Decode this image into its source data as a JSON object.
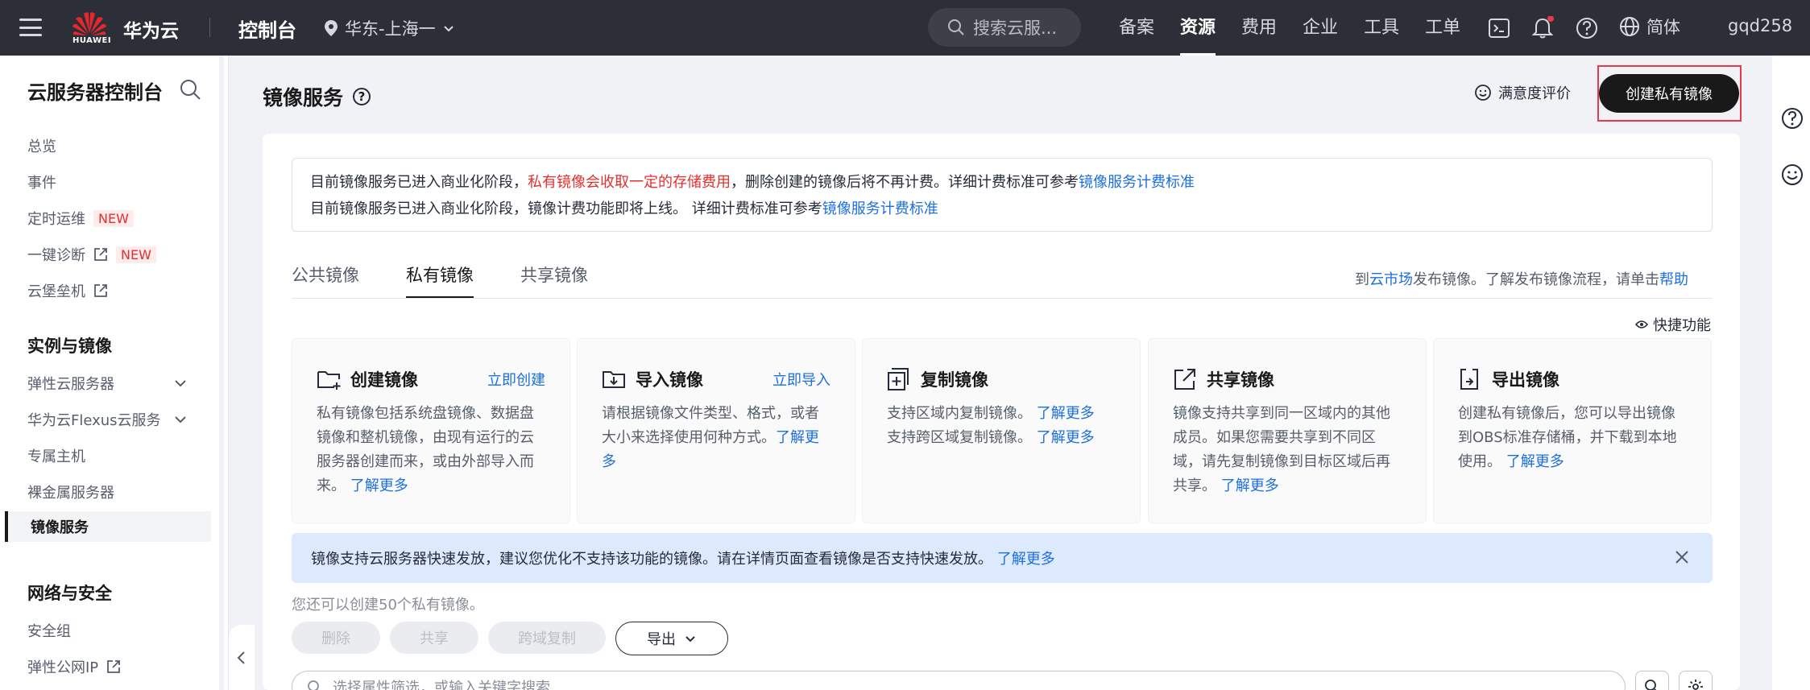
{
  "topbar": {
    "logo_text": "HUAWEI",
    "brand": "华为云",
    "console": "控制台",
    "region": "华东-上海一",
    "search_placeholder": "搜索云服...",
    "nav": [
      "备案",
      "资源",
      "费用",
      "企业",
      "工具",
      "工单"
    ],
    "active_nav": "资源",
    "language": "简体",
    "username": "gqd258"
  },
  "sidebar": {
    "title": "云服务器控制台",
    "items_top": [
      "总览",
      "事件"
    ],
    "scheduled_ops": "定时运维",
    "diagnosis": "一键诊断",
    "bastion": "云堡垒机",
    "new_badge": "NEW",
    "group_instances": "实例与镜像",
    "ecs": "弹性云服务器",
    "flexus": "华为云Flexus云服务",
    "dedicated_host": "专属主机",
    "bare_metal": "裸金属服务器",
    "ims": "镜像服务",
    "group_network": "网络与安全",
    "security_group": "安全组",
    "eip": "弹性公网IP"
  },
  "header": {
    "title": "镜像服务",
    "help_mark": "?",
    "satisfaction": "满意度评价",
    "create_button": "创建私有镜像"
  },
  "notice": {
    "line1_a": "目前镜像服务已进入商业化阶段，",
    "line1_red": "私有镜像会收取一定的存储费用",
    "line1_b": "，删除创建的镜像后将不再计费。详细计费标准可参考",
    "line1_link": "镜像服务计费标准",
    "line2_a": "目前镜像服务已进入商业化阶段，镜像计费功能即将上线。 详细计费标准可参考",
    "line2_link": "镜像服务计费标准"
  },
  "tabs": [
    "公共镜像",
    "私有镜像",
    "共享镜像"
  ],
  "active_tab": "私有镜像",
  "market_hint": {
    "pre": "到",
    "market_link": "云市场",
    "mid": "发布镜像。了解发布镜像流程，请单击",
    "help_link": "帮助"
  },
  "quick_feature": "快捷功能",
  "features": [
    {
      "title": "创建镜像",
      "action": "立即创建",
      "desc": "私有镜像包括系统盘镜像、数据盘镜像和整机镜像，由现有运行的云服务器创建而来，或由外部导入而来。",
      "more": "了解更多",
      "icon": "folder-create-icon"
    },
    {
      "title": "导入镜像",
      "action": "立即导入",
      "desc": "请根据镜像文件类型、格式，或者大小来选择使用何种方式。",
      "more": "了解更多",
      "icon": "folder-import-icon"
    },
    {
      "title": "复制镜像",
      "action": "",
      "desc1": "支持区域内复制镜像。",
      "desc2": "支持跨区域复制镜像。",
      "more": "了解更多",
      "icon": "copy-icon"
    },
    {
      "title": "共享镜像",
      "action": "",
      "desc": "镜像支持共享到同一区域内的其他成员。如果您需要共享到不同区域，请先复制镜像到目标区域后再共享。",
      "more": "了解更多",
      "icon": "share-icon"
    },
    {
      "title": "导出镜像",
      "action": "",
      "desc": "创建私有镜像后，您可以导出镜像到OBS标准存储桶，并下载到本地使用。",
      "more": "了解更多",
      "icon": "export-icon"
    }
  ],
  "banner": {
    "text": "镜像支持云服务器快速发放，建议您优化不支持该功能的镜像。请在详情页面查看镜像是否支持快速发放。",
    "link": "了解更多"
  },
  "quota": "您还可以创建50个私有镜像。",
  "actions": {
    "delete": "删除",
    "share": "共享",
    "cross_copy": "跨域复制",
    "export": "导出"
  },
  "filter_placeholder": "选择属性筛选，或输入关键字搜索",
  "colors": {
    "topbar": "#2d2f38",
    "link": "#1d6fe0",
    "highlight_red": "#e42f2f",
    "primary_button": "#191919",
    "banner_bg": "#ddeafd"
  }
}
